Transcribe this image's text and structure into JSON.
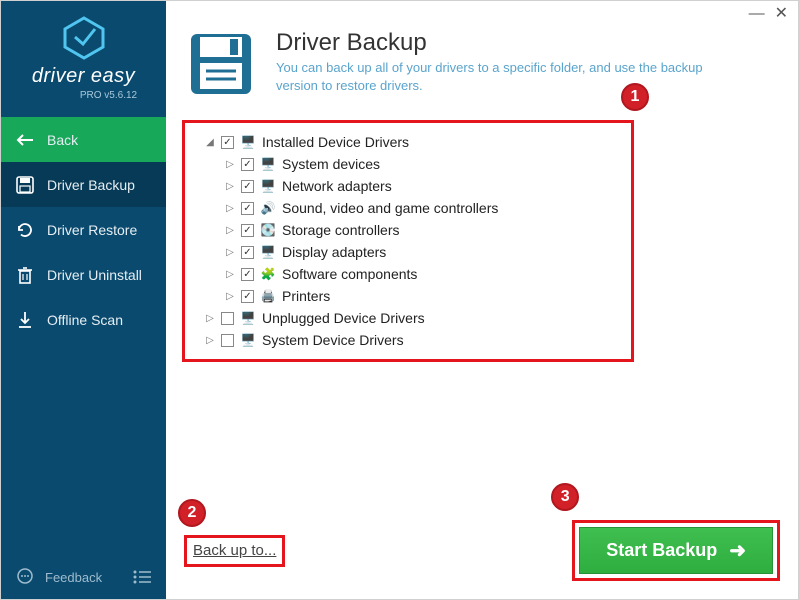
{
  "logo": {
    "text": "driver easy",
    "version": "PRO v5.6.12"
  },
  "nav": {
    "back": "Back",
    "backup": "Driver Backup",
    "restore": "Driver Restore",
    "uninstall": "Driver Uninstall",
    "offline": "Offline Scan",
    "feedback": "Feedback"
  },
  "header": {
    "title": "Driver Backup",
    "subtitle": "You can back up all of your drivers to a specific folder, and use the backup version to restore drivers."
  },
  "tree": {
    "root": "Installed Device Drivers",
    "children": [
      "System devices",
      "Network adapters",
      "Sound, video and game controllers",
      "Storage controllers",
      "Display adapters",
      "Software components",
      "Printers"
    ],
    "unplugged": "Unplugged Device Drivers",
    "systemdrv": "System Device Drivers"
  },
  "footer": {
    "backup_to": "Back up to...",
    "start": "Start Backup"
  },
  "callouts": {
    "one": "1",
    "two": "2",
    "three": "3"
  }
}
